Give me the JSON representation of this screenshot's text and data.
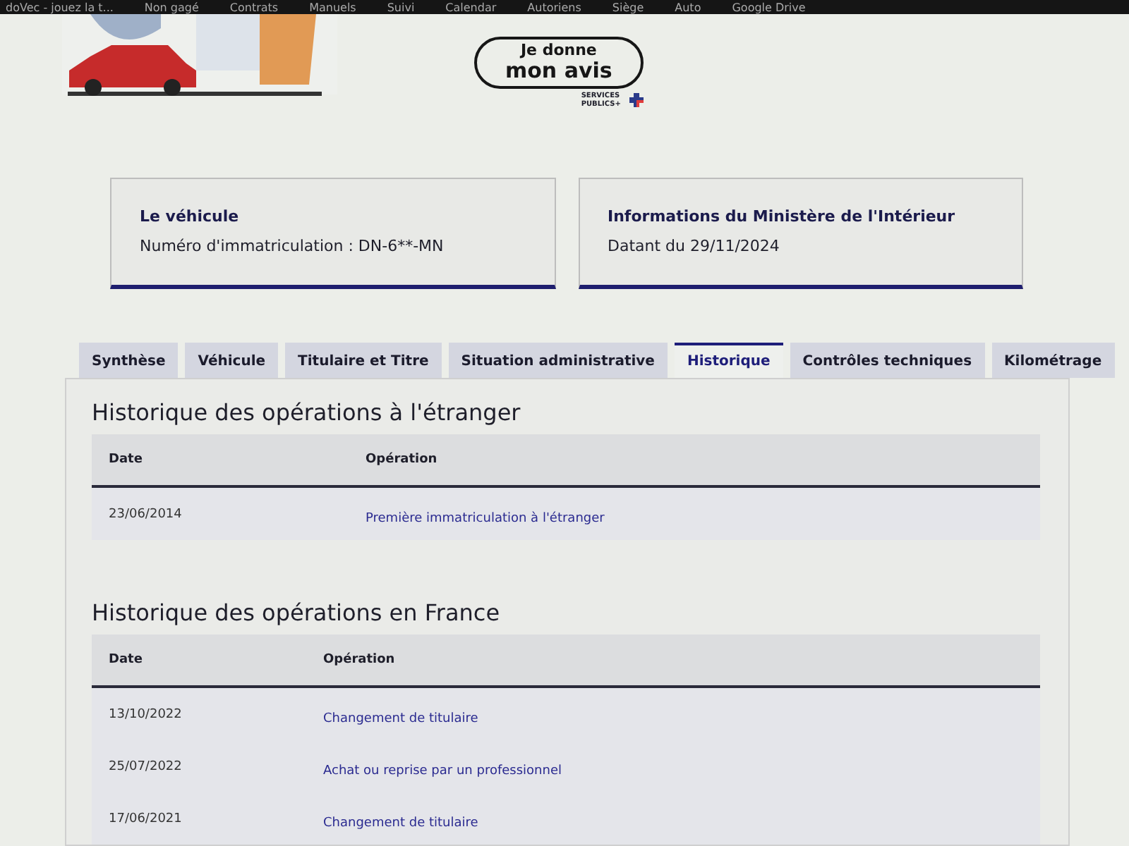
{
  "bookmarks": [
    "doVec - jouez la t...",
    "Non gagé",
    "Contrats",
    "Manuels",
    "Suivi",
    "Calendar",
    "Autoriens",
    "Siège",
    "Auto",
    "Google Drive"
  ],
  "feedback_button": {
    "line_1": "Je donne",
    "line_2": "mon avis",
    "brand": "SERVICES PUBLICS+"
  },
  "cards": [
    {
      "title": "Le véhicule",
      "text": "Numéro d'immatriculation : DN-6**-MN"
    },
    {
      "title": "Informations du Ministère de l'Intérieur",
      "text": "Datant du 29/11/2024"
    }
  ],
  "tabs": [
    {
      "label": "Synthèse",
      "selected": false
    },
    {
      "label": "Véhicule",
      "selected": false
    },
    {
      "label": "Titulaire et Titre",
      "selected": false
    },
    {
      "label": "Situation administrative",
      "selected": false
    },
    {
      "label": "Historique",
      "selected": true
    },
    {
      "label": "Contrôles techniques",
      "selected": false
    },
    {
      "label": "Kilométrage",
      "selected": false
    }
  ],
  "sections": [
    {
      "title": "Historique des opérations à l'étranger",
      "columns": [
        "Date",
        "Opération"
      ],
      "rows": [
        {
          "date": "23/06/2014",
          "operation": "Première immatriculation à l'étranger"
        }
      ]
    },
    {
      "title": "Historique des opérations en France",
      "columns": [
        "Date",
        "Opération"
      ],
      "rows": [
        {
          "date": "13/10/2022",
          "operation": "Changement de titulaire"
        },
        {
          "date": "25/07/2022",
          "operation": "Achat ou reprise par un professionnel"
        },
        {
          "date": "17/06/2021",
          "operation": "Changement de titulaire"
        }
      ]
    }
  ]
}
